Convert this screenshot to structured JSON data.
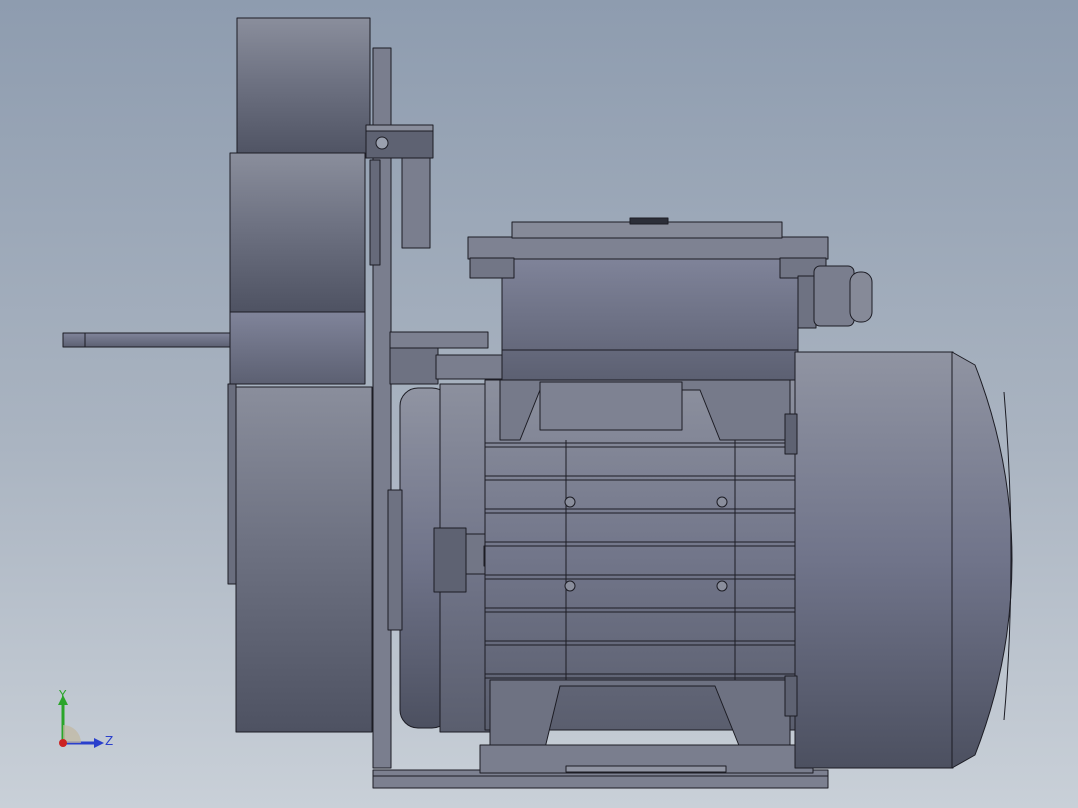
{
  "viewport": {
    "background_top": "#8e9caf",
    "background_bottom": "#c9d0d8"
  },
  "model": {
    "body_color": "#6f7383",
    "edge_color": "#1c1c24"
  },
  "triad": {
    "y_label": "Y",
    "z_label": "Z",
    "y_color": "#2aa52a",
    "z_color": "#2a3fcc",
    "x_color": "#cc2222"
  }
}
